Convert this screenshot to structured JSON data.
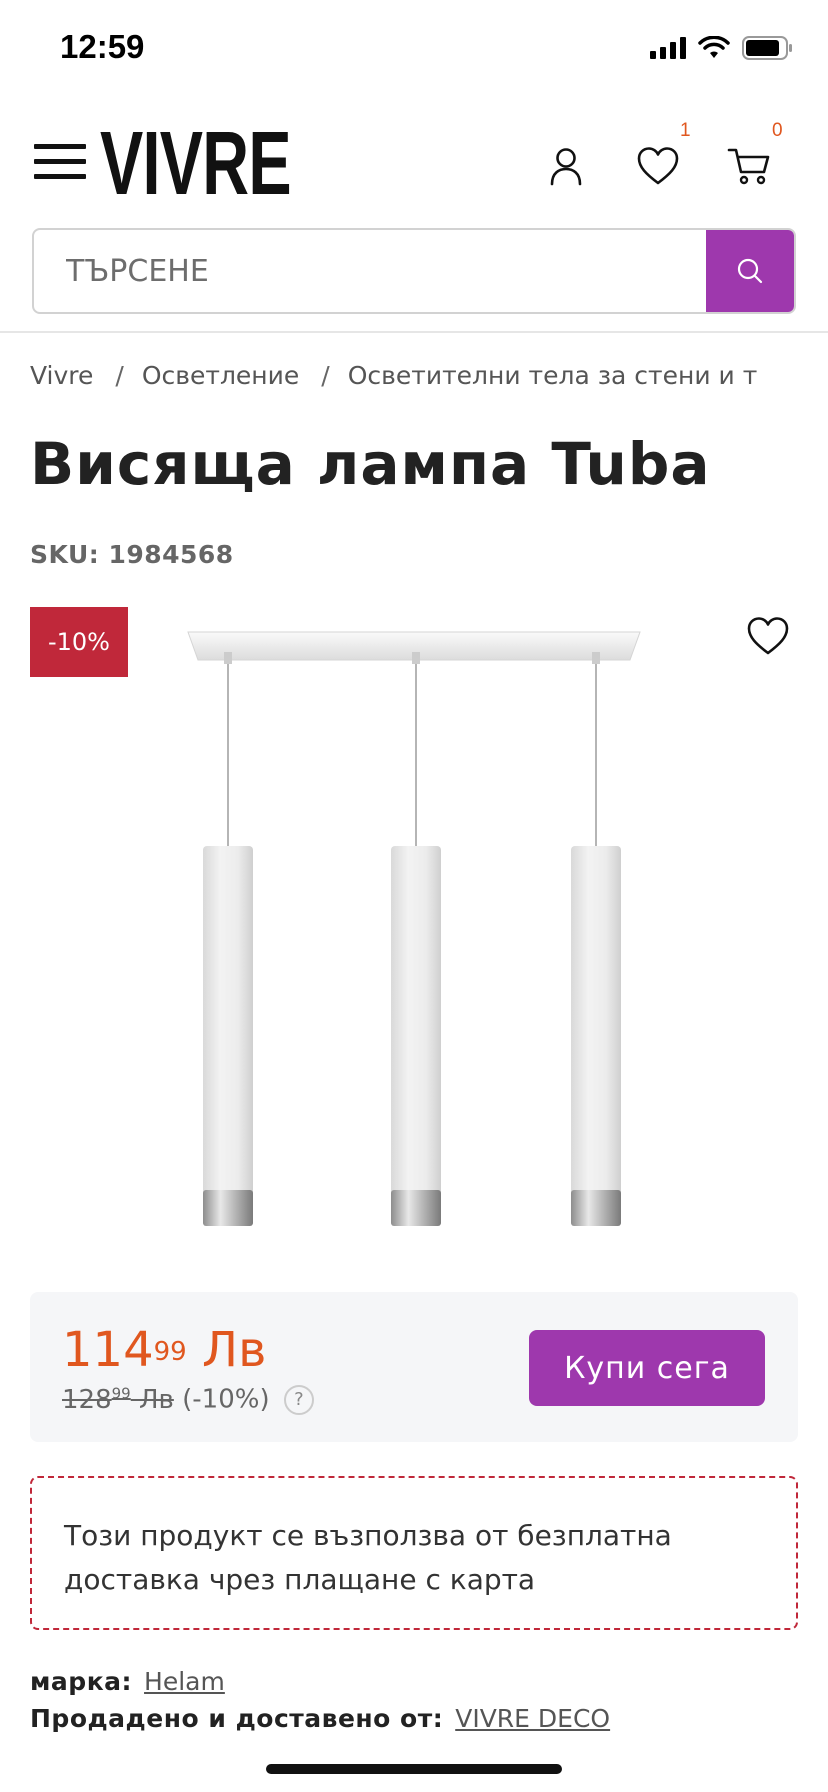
{
  "status_bar": {
    "time": "12:59"
  },
  "header": {
    "logo": "VIVRE",
    "wishlist_count": "1",
    "cart_count": "0"
  },
  "search": {
    "placeholder": "ТЪРСЕНЕ"
  },
  "breadcrumb": {
    "items": [
      "Vivre",
      "Осветление",
      "Осветителни тела за стени и т"
    ]
  },
  "product": {
    "title": "Висяща лампа Tuba",
    "sku": "SKU: 1984568",
    "discount_badge": "-10%"
  },
  "price": {
    "current_int": "114",
    "current_dec": "99",
    "currency": "Лв",
    "old_int": "128",
    "old_dec": "99",
    "old_currency": "Лв",
    "discount": "(-10%)",
    "help": "?"
  },
  "buy_button": "Купи сега",
  "delivery_note": "Този продукт се възползва от безплатна доставка чрез плащане с карта",
  "meta": {
    "brand_label": "марка:",
    "brand_value": "Helam",
    "seller_label": "Продадено и доставено от:",
    "seller_value": "VIVRE DECO"
  },
  "colors": {
    "accent": "#9e38ad",
    "price": "#e0571f",
    "badge": "#c0283a"
  }
}
